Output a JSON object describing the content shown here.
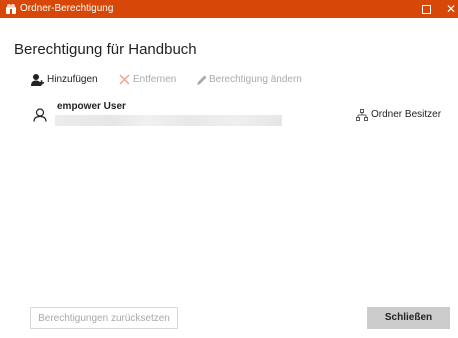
{
  "window": {
    "title": "Ordner-Berechtigung",
    "app_icon": "folder-people-icon",
    "controls": {
      "maximize_icon": "maximize-icon",
      "close_icon": "close-icon",
      "close_glyph": "✕"
    },
    "titlebar_color": "#d74708"
  },
  "heading": "Berechtigung für Handbuch",
  "toolbar": {
    "add_label": "Hinzufügen",
    "add_icon": "add-user-icon",
    "remove_label": "Entfernen",
    "remove_icon": "remove-x-icon",
    "change_label": "Berechtigung ändern",
    "change_icon": "pencil-icon",
    "disabled_color": "#aaaaaa",
    "remove_icon_color": "#f4a090"
  },
  "users": [
    {
      "name": "empower User",
      "icon": "user-icon",
      "role": "Ordner Besitzer",
      "role_icon": "hierarchy-icon"
    }
  ],
  "footer": {
    "reset_label": "Berechtigungen zurücksetzen",
    "close_label": "Schließen"
  }
}
